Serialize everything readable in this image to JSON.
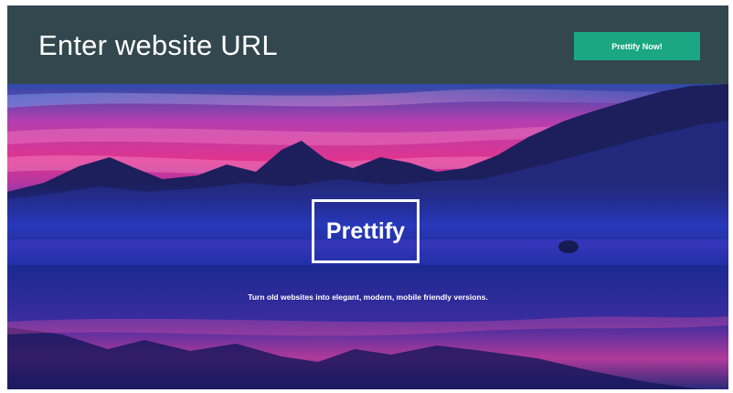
{
  "header": {
    "url_placeholder": "Enter website URL",
    "submit_label": "Prettify Now!"
  },
  "hero": {
    "logo_text": "Prettify",
    "tagline": "Turn old websites into elegant, modern, mobile friendly versions."
  },
  "colors": {
    "header_bg": "#33474f",
    "button_bg": "#1aa781",
    "text": "#ffffff"
  }
}
